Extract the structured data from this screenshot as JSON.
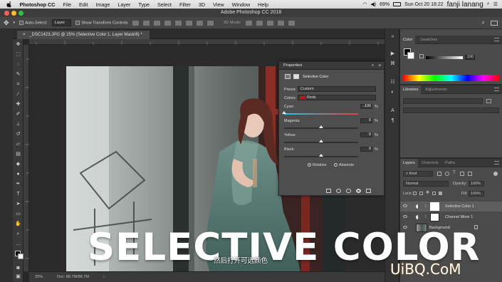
{
  "menubar": {
    "app_name": "Photoshop CC",
    "items": [
      "File",
      "Edit",
      "Image",
      "Layer",
      "Type",
      "Select",
      "Filter",
      "3D",
      "View",
      "Window",
      "Help"
    ],
    "battery": "69%",
    "clock": "Sun Oct 20  18:22",
    "user": "fanji lanang"
  },
  "window": {
    "title": "Adobe Photoshop CC 2018"
  },
  "options": {
    "auto_select_label": "Auto-Select:",
    "auto_select_value": "Layer",
    "transform_label": "Show Transform Controls",
    "mode_label": "3D Mode:"
  },
  "document": {
    "tab_title": "_DSC1423.JPG @ 25% (Selective Color 1, Layer Mask/8) *"
  },
  "status": {
    "zoom": "25%",
    "doc": "Doc: 88.7M/88.7M"
  },
  "properties": {
    "title": "Properties",
    "adjustment": "Selective Color",
    "preset_label": "Preset:",
    "preset_value": "Custom",
    "colors_label": "Colors:",
    "colors_value": "Reds",
    "sliders": [
      {
        "label": "Cyan:",
        "value": "-100",
        "unit": "%",
        "level": -100
      },
      {
        "label": "Magenta:",
        "value": "0",
        "unit": "%",
        "level": 0
      },
      {
        "label": "Yellow:",
        "value": "0",
        "unit": "%",
        "level": 0
      },
      {
        "label": "Black:",
        "value": "0",
        "unit": "%",
        "level": 0
      }
    ],
    "relative_label": "Relative",
    "absolute_label": "Absolute",
    "method": "Relative"
  },
  "color_panel": {
    "tabs": [
      "Color",
      "Swatches"
    ],
    "slider_value": "100"
  },
  "libraries_panel": {
    "tabs": [
      "Libraries",
      "Adjustments"
    ]
  },
  "layers_panel": {
    "tabs": [
      "Layers",
      "Channels",
      "Paths"
    ],
    "filter_kind": "Kind",
    "blend_mode": "Normal",
    "opacity_label": "Opacity:",
    "opacity_value": "100%",
    "lock_label": "Lock:",
    "fill_label": "Fill:",
    "fill_value": "100%",
    "layers": [
      {
        "name": "Selective Color 1"
      },
      {
        "name": "Channel Mixer 1"
      },
      {
        "name": "Background"
      }
    ]
  },
  "overlay": {
    "title": "SELECTIVE COLOR",
    "subtitle": "然后打开可选颜色",
    "watermark": "UiBQ.CoM"
  },
  "colors": {
    "accent_red": "#b01a1a",
    "panel": "#4b4b4b",
    "canvas": "#2b2b2b"
  }
}
